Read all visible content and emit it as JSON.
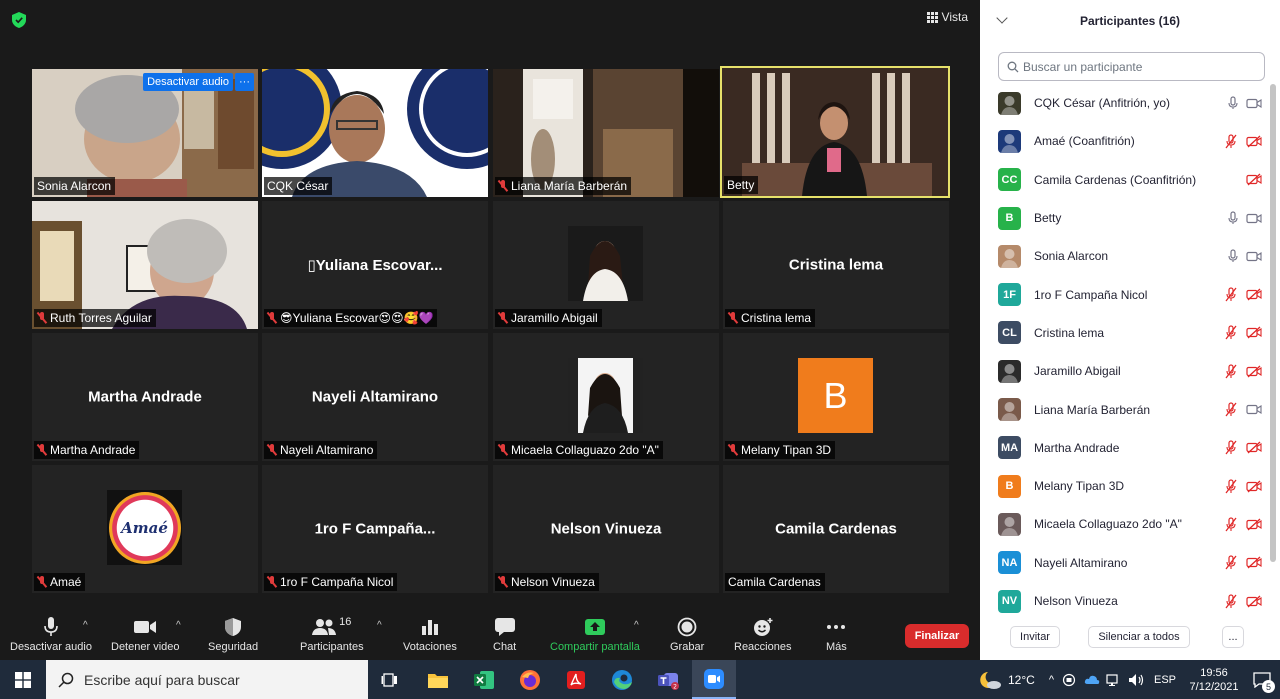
{
  "meeting": {
    "view_label": "Vista",
    "tiles": [
      {
        "name": "Sonia Alarcon",
        "muted": false,
        "overlay": {
          "audio_btn": "Desactivar audio",
          "more_btn": "···"
        }
      },
      {
        "name": "CQK César",
        "muted": false
      },
      {
        "name": "Liana María Barberán",
        "muted": true
      },
      {
        "name": "Betty",
        "muted": false,
        "active": true
      },
      {
        "name": "Ruth Torres Aguilar",
        "muted": true
      },
      {
        "name": "😎Yuliana Escovar😍😍🥰💜",
        "center": "▯Yuliana  Escovar...",
        "muted": true
      },
      {
        "name": "Jaramillo Abigail",
        "muted": true
      },
      {
        "name": "Cristina lema",
        "center": "Cristina lema",
        "muted": true
      },
      {
        "name": "Martha Andrade",
        "center": "Martha Andrade",
        "muted": true
      },
      {
        "name": "Nayeli Altamirano",
        "center": "Nayeli Altamirano",
        "muted": true
      },
      {
        "name": "Micaela Collaguazo 2do \"A\"",
        "muted": true
      },
      {
        "name": "Melany Tipan 3D",
        "muted": true,
        "avatar_letter": "B"
      },
      {
        "name": "Amaé",
        "muted": true,
        "logo_text": "Amaé"
      },
      {
        "name": "1ro F Campaña Nicol",
        "center": "1ro F Campaña...",
        "muted": true
      },
      {
        "name": "Nelson Vinueza",
        "center": "Nelson Vinueza",
        "muted": true
      },
      {
        "name": "Camila Cardenas",
        "center": "Camila Cardenas",
        "muted": false
      }
    ]
  },
  "toolbar": {
    "mute_audio": "Desactivar audio",
    "stop_video": "Detener video",
    "security": "Seguridad",
    "participants": "Participantes",
    "participants_count": "16",
    "polls": "Votaciones",
    "chat": "Chat",
    "share_screen": "Compartir pantalla",
    "record": "Grabar",
    "reactions": "Reacciones",
    "more": "Más",
    "end": "Finalizar"
  },
  "panel": {
    "title": "Participantes (16)",
    "search_placeholder": "Buscar un participante",
    "participants": [
      {
        "name": "CQK César (Anfitrión, yo)",
        "avatar": "img",
        "color": "#3a3a2a",
        "audio": "on",
        "video": "on"
      },
      {
        "name": "Amaé (Coanfitrión)",
        "avatar": "img",
        "color": "#1d3a7a",
        "audio": "off",
        "video": "off"
      },
      {
        "name": "Camila Cardenas (Coanfitrión)",
        "avatar": "CC",
        "color": "#27b24a",
        "audio": "none",
        "video": "off"
      },
      {
        "name": "Betty",
        "avatar": "B",
        "color": "#27b24a",
        "audio": "on",
        "video": "on"
      },
      {
        "name": "Sonia Alarcon",
        "avatar": "img",
        "color": "#b58a6a",
        "audio": "on",
        "video": "on"
      },
      {
        "name": "1ro F Campaña Nicol",
        "avatar": "1F",
        "color": "#1fa89a",
        "audio": "off",
        "video": "off"
      },
      {
        "name": "Cristina lema",
        "avatar": "CL",
        "color": "#3d4c63",
        "audio": "off",
        "video": "off"
      },
      {
        "name": "Jaramillo Abigail",
        "avatar": "img",
        "color": "#2b2b2b",
        "audio": "off",
        "video": "off"
      },
      {
        "name": "Liana María Barberán",
        "avatar": "img",
        "color": "#7a5a4a",
        "audio": "off",
        "video": "on"
      },
      {
        "name": "Martha Andrade",
        "avatar": "MA",
        "color": "#3d4c63",
        "audio": "off",
        "video": "off"
      },
      {
        "name": "Melany Tipan 3D",
        "avatar": "B",
        "color": "#f07c1c",
        "audio": "off",
        "video": "off"
      },
      {
        "name": "Micaela Collaguazo 2do \"A\"",
        "avatar": "img",
        "color": "#6a5a5a",
        "audio": "off",
        "video": "off"
      },
      {
        "name": "Nayeli Altamirano",
        "avatar": "NA",
        "color": "#1a8fd6",
        "audio": "off",
        "video": "off"
      },
      {
        "name": "Nelson Vinueza",
        "avatar": "NV",
        "color": "#1fa89a",
        "audio": "off",
        "video": "off"
      }
    ],
    "invite": "Invitar",
    "mute_all": "Silenciar a todos",
    "more": "..."
  },
  "taskbar": {
    "search_placeholder": "Escribe aquí para buscar",
    "weather": "12°C",
    "language": "ESP",
    "time": "19:56",
    "date": "7/12/2021",
    "notifications": "5"
  }
}
